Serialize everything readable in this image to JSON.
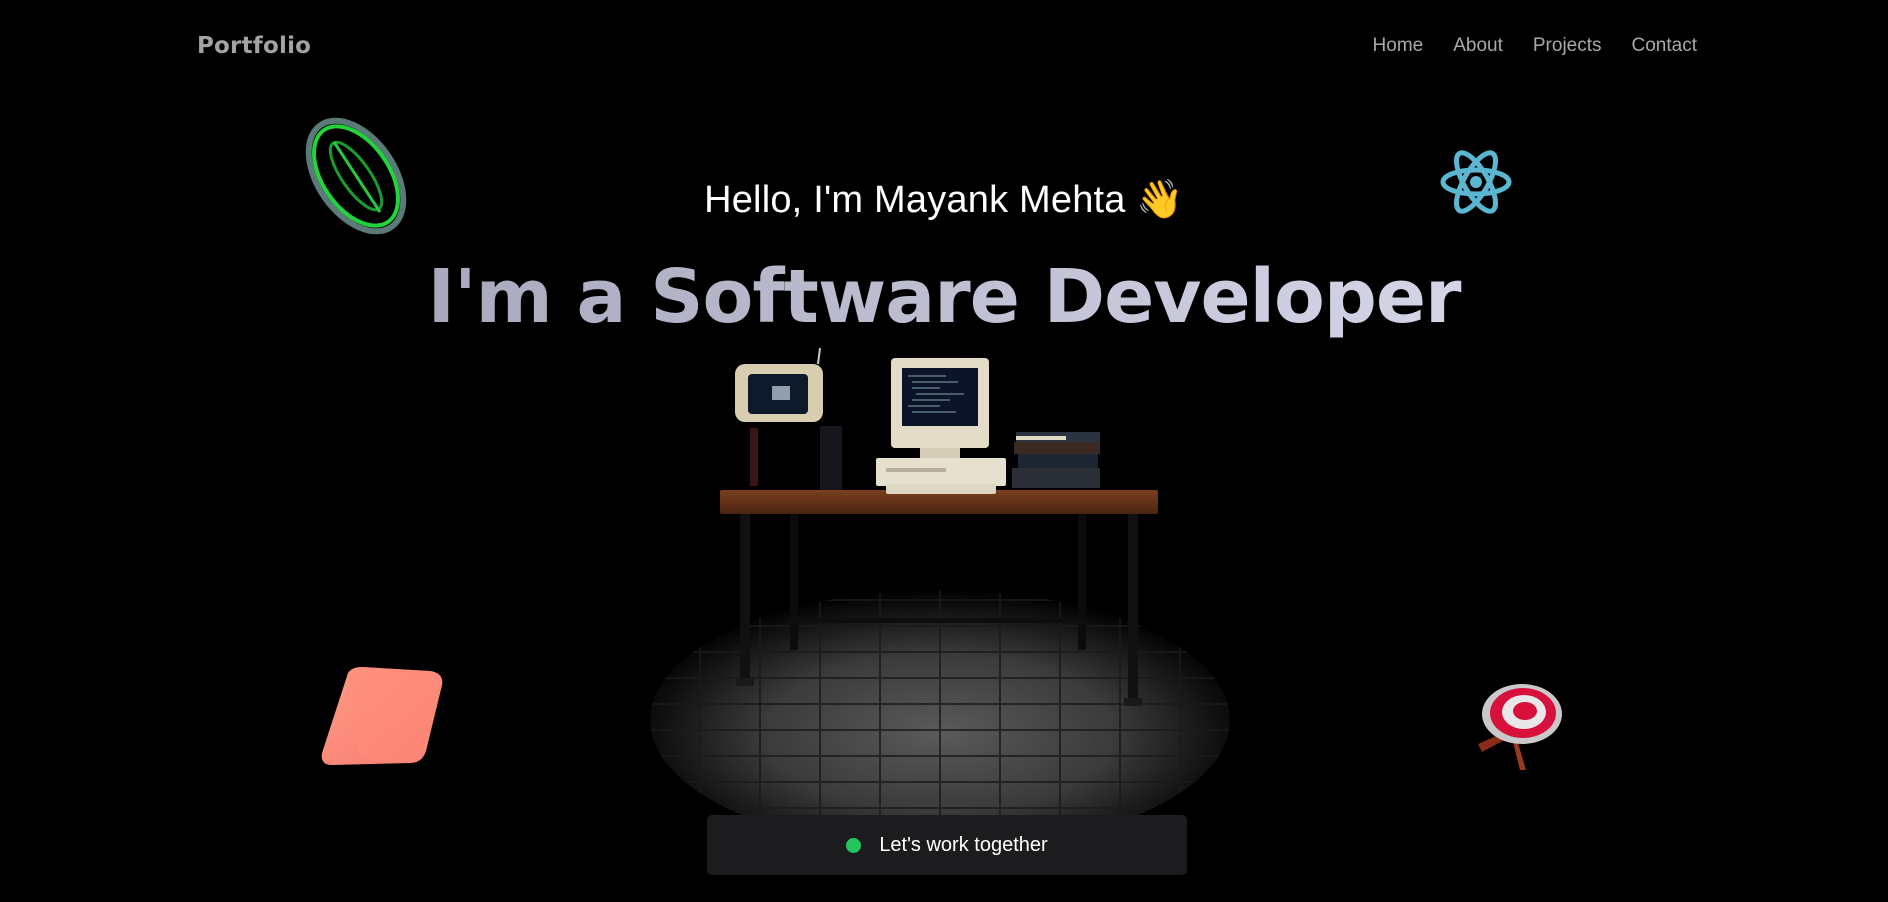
{
  "nav": {
    "logo": "Portfolio",
    "links": [
      "Home",
      "About",
      "Projects",
      "Contact"
    ]
  },
  "hero": {
    "greeting": "Hello, I'm Mayank Mehta",
    "wave_emoji": "👋",
    "headline": "I'm a Software Developer"
  },
  "cta": {
    "label": "Let's work together",
    "status_color": "#22c55e"
  },
  "icons": {
    "top_left": "ring-object-icon",
    "top_right": "react-logo-icon",
    "bottom_left": "pink-cube-icon",
    "bottom_right": "target-icon"
  }
}
